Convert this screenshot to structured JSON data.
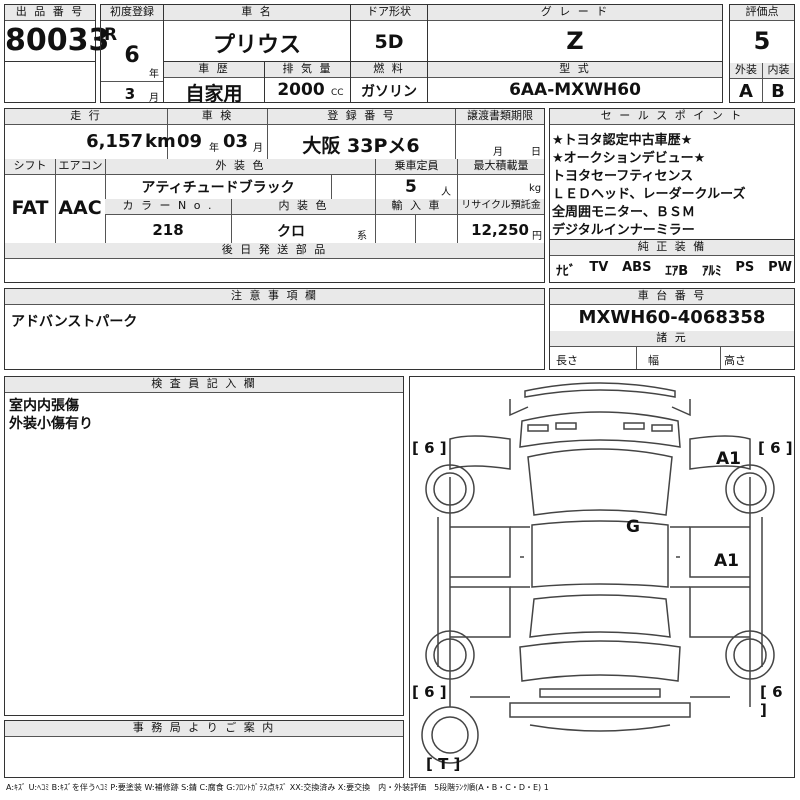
{
  "header": {
    "lot_label": "出 品 番 号",
    "lot_number": "80033",
    "first_reg_label": "初度登録",
    "era": "R",
    "year_value": "6",
    "year_unit": "年",
    "month_value": "3",
    "month_unit": "月",
    "car_name_label": "車 名",
    "car_name": "プリウス",
    "door_label": "ドア形状",
    "door": "5D",
    "grade_label": "グ レ ー ド",
    "grade": "Z",
    "score_label": "評価点",
    "score": "5",
    "history_label": "車 歴",
    "history": "自家用",
    "displacement_label": "排 気 量",
    "displacement": "2000",
    "displacement_unit": "CC",
    "fuel_label": "燃 料",
    "fuel": "ガソリン",
    "model_label": "型 式",
    "model": "6AA-MXWH60",
    "ext_label": "外装",
    "int_label": "内装",
    "ext_grade": "A",
    "int_grade": "B"
  },
  "details": {
    "mileage_label": "走 行",
    "mileage": "6,157",
    "mileage_unit": "km",
    "inspection_label": "車 検",
    "insp_year": "09",
    "insp_year_unit": "年",
    "insp_month": "03",
    "insp_month_unit": "月",
    "reg_label": "登 録 番 号",
    "reg_number": "大阪 33Pメ6",
    "transfer_label": "譲渡書類期限",
    "transfer_month_unit": "月",
    "transfer_day_unit": "日",
    "shift_label": "シフト",
    "shift": "FAT",
    "ac_label": "エアコン",
    "ac": "AAC",
    "ext_color_label": "外 装 色",
    "ext_color": "アティチュードブラック",
    "capacity_label": "乗車定員",
    "capacity": "5",
    "capacity_unit": "人",
    "load_label": "最大積載量",
    "load_unit": "kg",
    "color_no_label": "カ ラ ー N o .",
    "color_no": "218",
    "int_color_label": "内 装 色",
    "int_color": "クロ",
    "int_color_unit": "系",
    "import_label": "輸 入 車",
    "recycle_label": "リサイクル預託金",
    "recycle": "12,250",
    "recycle_unit": "円",
    "later_parts_label": "後 日 発 送 部 品"
  },
  "sales_points": {
    "label": "セ ー ル ス ポ イ ン ト",
    "lines": [
      "★トヨタ認定中古車歴★",
      "★オークションデビュー★",
      "トヨタセーフティセンス",
      "ＬＥＤヘッド、レーダークルーズ",
      "全周囲モニター、ＢＳＭ",
      "デジタルインナーミラー"
    ]
  },
  "equipment": {
    "label": "純 正 装 備",
    "items": [
      "ﾅﾋﾞ",
      "TV",
      "ABS",
      "ｴｱB",
      "ｱﾙﾐ",
      "PS",
      "PW"
    ]
  },
  "notes": {
    "label": "注 意 事 項 欄",
    "text": "アドバンストパーク"
  },
  "chassis": {
    "label": "車 台 番 号",
    "number": "MXWH60-4068358",
    "specs_label": "諸 元",
    "length_label": "長さ",
    "width_label": "幅",
    "height_label": "高さ"
  },
  "inspector": {
    "label": "検 査 員 記 入 欄",
    "lines": [
      "室内内張傷",
      "外装小傷有り"
    ]
  },
  "office": {
    "label": "事 務 局 よ り ご 案 内"
  },
  "diagram": {
    "tire_fl": "[ 6 ]",
    "tire_fr": "[ 6 ]",
    "tire_rl": "[ 6 ]",
    "tire_rr": "[ 6 ]",
    "spare": "[ T ]",
    "mark_a1_top": "A1",
    "mark_g": "G",
    "mark_a1_mid": "A1"
  },
  "legend": "A:ｷｽﾞ U:ﾍｺﾐ B:ｷｽﾞを伴うﾍｺﾐ P:要塗装 W:補修跡 S:錆 C:腐食 G:ﾌﾛﾝﾄｶﾞﾗｽ点ｷｽﾞ XX:交換済み X:要交換　内・外装評価　5段階ﾗﾝｸ順(A・B・C・D・E) 1"
}
